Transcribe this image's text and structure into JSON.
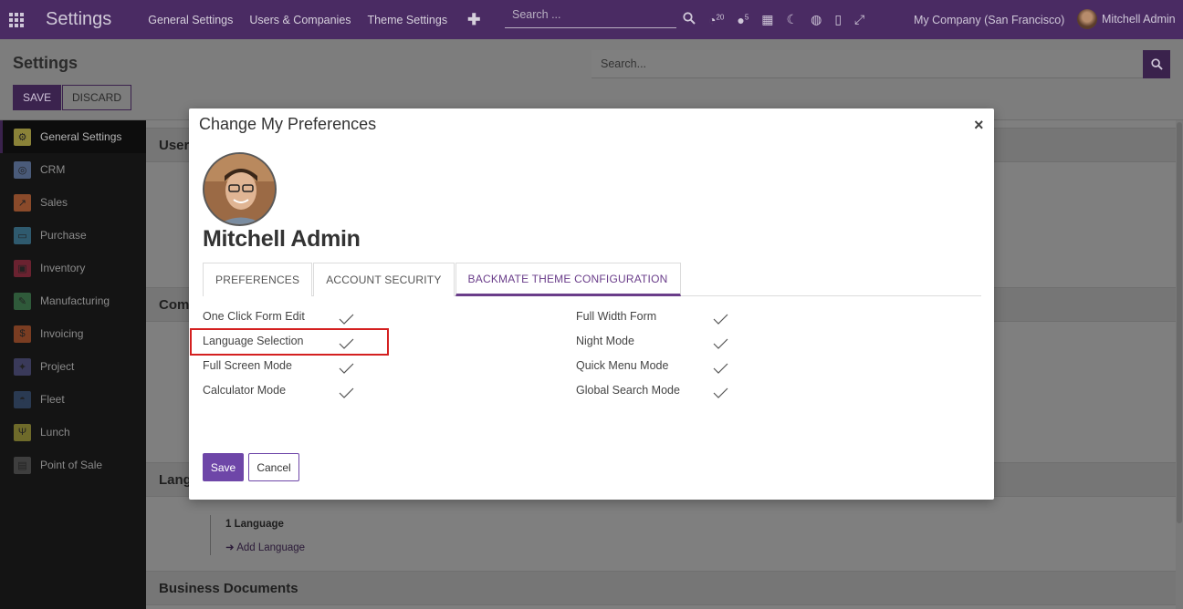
{
  "navbar": {
    "app_title": "Settings",
    "menu": [
      "General Settings",
      "Users & Companies",
      "Theme Settings"
    ],
    "search_placeholder": "Search ...",
    "activity_count": "20",
    "message_count": "5",
    "company": "My Company (San Francisco)",
    "user": "Mitchell Admin"
  },
  "control": {
    "breadcrumb": "Settings",
    "save_label": "SAVE",
    "discard_label": "DISCARD",
    "search_placeholder": "Search..."
  },
  "sidebar": {
    "items": [
      {
        "label": "General Settings",
        "color": "#8a8238"
      },
      {
        "label": "CRM",
        "color": "#4a5b7a"
      },
      {
        "label": "Sales",
        "color": "#8a4a2a"
      },
      {
        "label": "Purchase",
        "color": "#2f5a6e"
      },
      {
        "label": "Inventory",
        "color": "#6a2230"
      },
      {
        "label": "Manufacturing",
        "color": "#2f5a3a"
      },
      {
        "label": "Invoicing",
        "color": "#7a3d22"
      },
      {
        "label": "Project",
        "color": "#3a3a5a"
      },
      {
        "label": "Fleet",
        "color": "#2a3a52"
      },
      {
        "label": "Lunch",
        "color": "#6e6a2a"
      },
      {
        "label": "Point of Sale",
        "color": "#3e3e3e"
      }
    ]
  },
  "content": {
    "sections": [
      "Users",
      "Companies",
      "Languages",
      "Business Documents"
    ],
    "language_count": "1 Language",
    "add_language": "Add Language"
  },
  "modal": {
    "title": "Change My Preferences",
    "user_name": "Mitchell Admin",
    "tabs": [
      "PREFERENCES",
      "ACCOUNT SECURITY",
      "BACKMATE THEME CONFIGURATION"
    ],
    "active_tab": "BACKMATE THEME CONFIGURATION",
    "left_options": [
      "One Click Form Edit",
      "Language Selection",
      "Full Screen Mode",
      "Calculator Mode"
    ],
    "right_options": [
      "Full Width Form",
      "Night Mode",
      "Quick Menu Mode",
      "Global Search Mode"
    ],
    "highlighted_option": "Language Selection",
    "save_label": "Save",
    "cancel_label": "Cancel"
  }
}
